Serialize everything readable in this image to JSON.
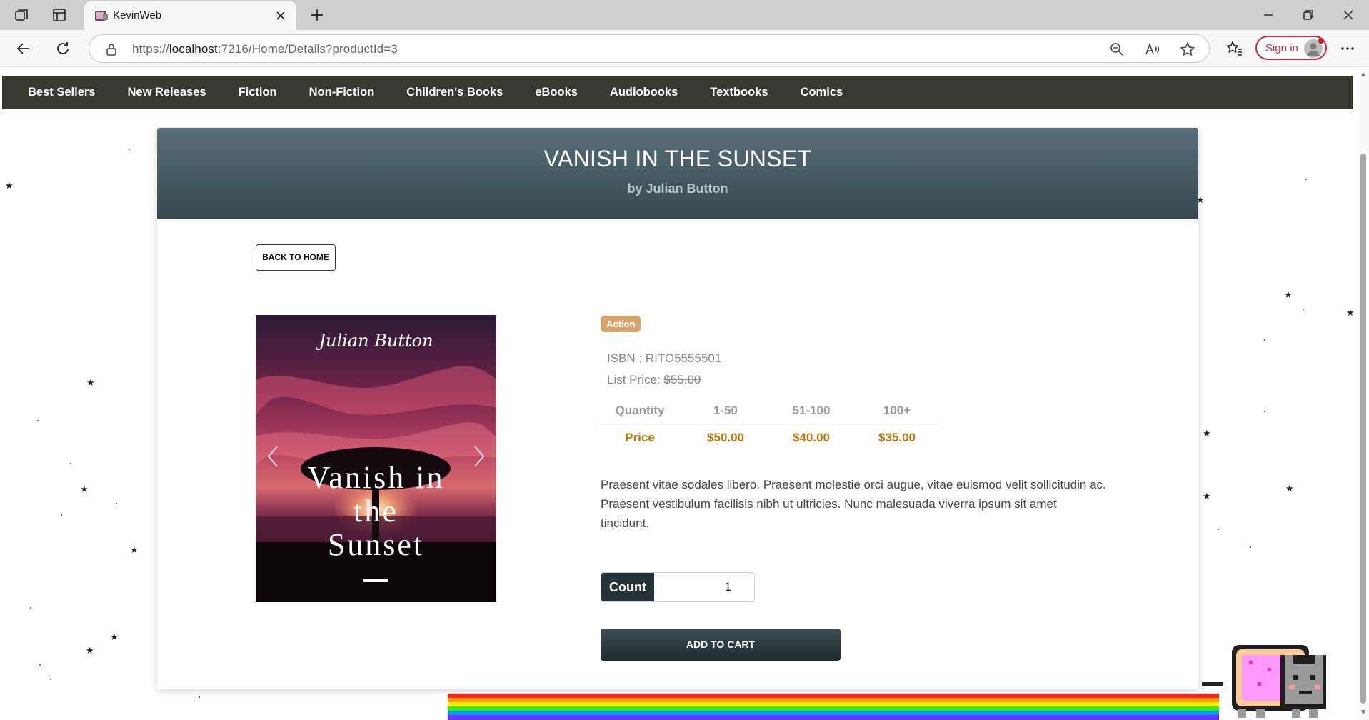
{
  "browser": {
    "tab_title": "KevinWeb",
    "url_prefix": "https://",
    "url_host": "localhost",
    "url_rest": ":7216/Home/Details?productId=3",
    "sign_in_label": "Sign in"
  },
  "nav": {
    "items": [
      "Best Sellers",
      "New Releases",
      "Fiction",
      "Non-Fiction",
      "Children's Books",
      "eBooks",
      "Audiobooks",
      "Textbooks",
      "Comics"
    ]
  },
  "product": {
    "title": "VANISH IN THE SUNSET",
    "author_line": "by Julian Button",
    "back_label": "BACK TO HOME",
    "cover_author": "Julian Button",
    "cover_title_lines": [
      "Vanish in",
      "the",
      "Sunset"
    ],
    "category_badge": "Action",
    "isbn": "ISBN : RITO5555501",
    "list_price_label": "List Price: ",
    "list_price_value": "$55.00",
    "pricing": {
      "headers": [
        "Quantity",
        "1-50",
        "51-100",
        "100+"
      ],
      "values": [
        "Price",
        "$50.00",
        "$40.00",
        "$35.00"
      ]
    },
    "description": "Praesent vitae sodales libero. Praesent molestie orci augue, vitae euismod velit sollicitudin ac. Praesent vestibulum facilisis nibh ut ultricies. Nunc malesuada viverra ipsum sit amet tincidunt.",
    "count_label": "Count",
    "count_value": "1",
    "add_to_cart_label": "ADD TO CART"
  },
  "colors": {
    "nav_bg": "#36392f",
    "header_gradient_top": "#57707a",
    "header_gradient_bottom": "#36474e",
    "badge": "#d6a36c",
    "price_accent": "#c07a12",
    "button_dark": "#243338",
    "signin_red": "#c7253e"
  },
  "icons": {
    "tab_actions": "workspaces-icon",
    "vertical_tabs": "vertical-tabs-icon",
    "back": "arrow-left-icon",
    "refresh": "refresh-icon",
    "lock": "lock-icon",
    "zoom": "zoom-out-icon",
    "read_aloud": "read-aloud-icon",
    "favorite": "star-icon",
    "favorites": "favorites-icon",
    "more": "more-icon"
  }
}
